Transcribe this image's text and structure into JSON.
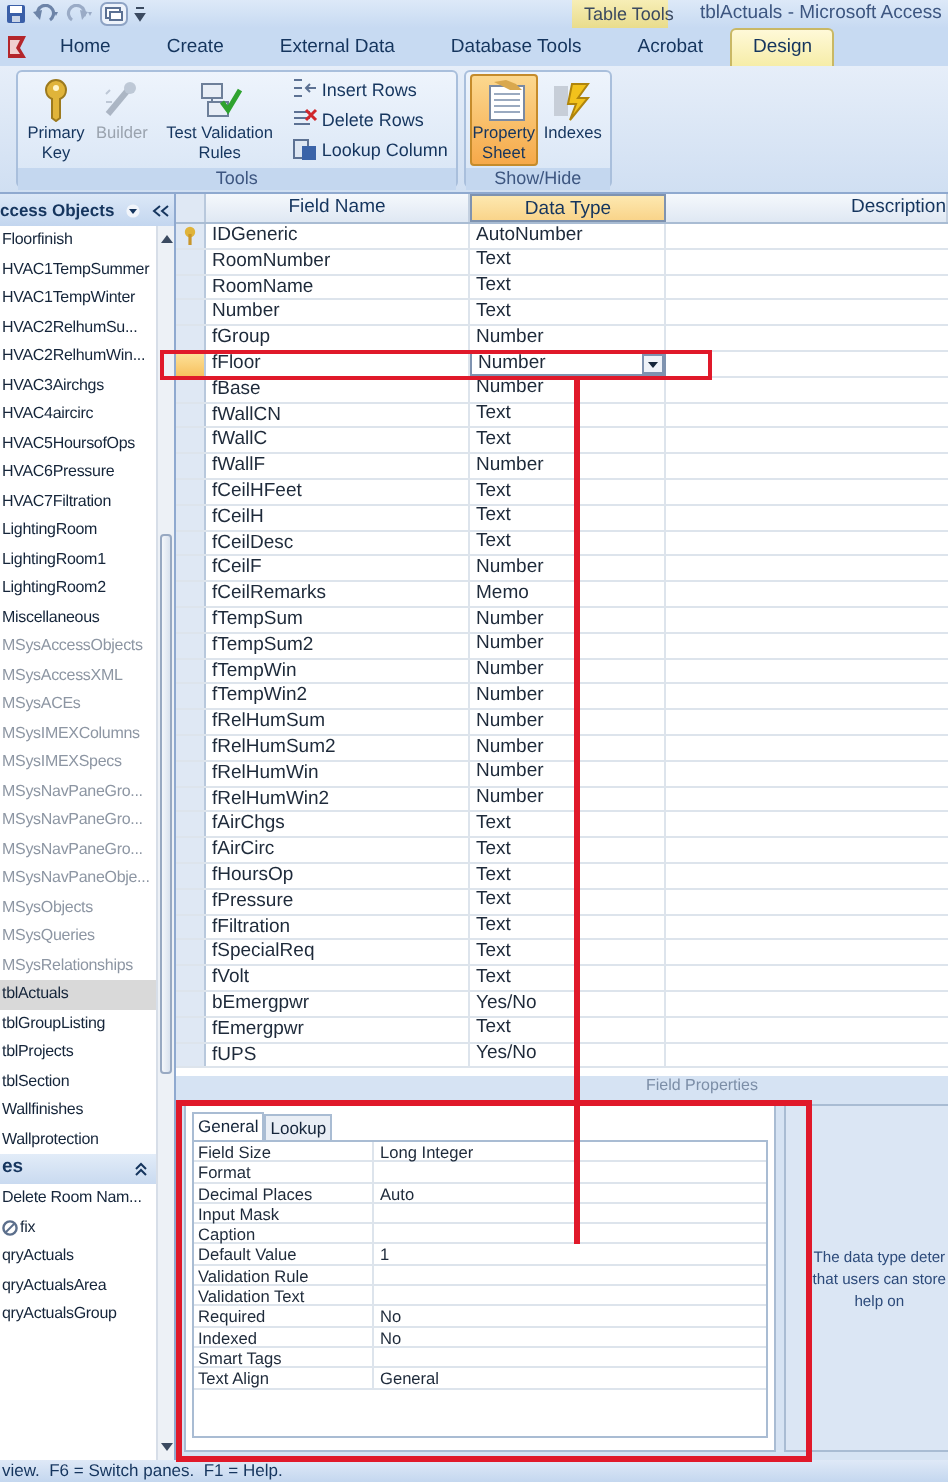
{
  "window": {
    "context_label": "Table Tools",
    "title": "tblActuals - Microsoft Access"
  },
  "tabs": [
    {
      "label": "Home",
      "selected": false
    },
    {
      "label": "Create",
      "selected": false
    },
    {
      "label": "External Data",
      "selected": false
    },
    {
      "label": "Database Tools",
      "selected": false
    },
    {
      "label": "Acrobat",
      "selected": false
    },
    {
      "label": "Design",
      "selected": true
    }
  ],
  "ribbon": {
    "groups": [
      {
        "label": "Tools",
        "buttons": [
          {
            "kind": "large",
            "label": "Primary Key",
            "disabled": false,
            "selected": false
          },
          {
            "kind": "large",
            "label": "Builder",
            "disabled": true,
            "selected": false
          },
          {
            "kind": "large",
            "label": "Test Validation Rules",
            "disabled": false,
            "selected": false
          },
          {
            "kind": "small",
            "label": "Insert Rows",
            "disabled": false,
            "selected": false
          },
          {
            "kind": "small",
            "label": "Delete Rows",
            "disabled": false,
            "selected": false
          },
          {
            "kind": "small",
            "label": "Lookup Column",
            "disabled": false,
            "selected": false
          }
        ]
      },
      {
        "label": "Show/Hide",
        "buttons": [
          {
            "kind": "large",
            "label": "Property Sheet",
            "disabled": false,
            "selected": true
          },
          {
            "kind": "large",
            "label": "Indexes",
            "disabled": false,
            "selected": false
          }
        ]
      }
    ]
  },
  "nav": {
    "header": "ccess Objects",
    "groups": [
      {
        "items": [
          {
            "label": "Floorfinish",
            "dimmed": false,
            "selected": false
          },
          {
            "label": "HVAC1TempSummer",
            "dimmed": false,
            "selected": false
          },
          {
            "label": "HVAC1TempWinter",
            "dimmed": false,
            "selected": false
          },
          {
            "label": "HVAC2RelhumSu...",
            "dimmed": false,
            "selected": false
          },
          {
            "label": "HVAC2RelhumWin...",
            "dimmed": false,
            "selected": false
          },
          {
            "label": "HVAC3Airchgs",
            "dimmed": false,
            "selected": false
          },
          {
            "label": "HVAC4aircirc",
            "dimmed": false,
            "selected": false
          },
          {
            "label": "HVAC5HoursofOps",
            "dimmed": false,
            "selected": false
          },
          {
            "label": "HVAC6Pressure",
            "dimmed": false,
            "selected": false
          },
          {
            "label": "HVAC7Filtration",
            "dimmed": false,
            "selected": false
          },
          {
            "label": "LightingRoom",
            "dimmed": false,
            "selected": false
          },
          {
            "label": "LightingRoom1",
            "dimmed": false,
            "selected": false
          },
          {
            "label": "LightingRoom2",
            "dimmed": false,
            "selected": false
          },
          {
            "label": "Miscellaneous",
            "dimmed": false,
            "selected": false
          },
          {
            "label": "MSysAccessObjects",
            "dimmed": true,
            "selected": false
          },
          {
            "label": "MSysAccessXML",
            "dimmed": true,
            "selected": false
          },
          {
            "label": "MSysACEs",
            "dimmed": true,
            "selected": false
          },
          {
            "label": "MSysIMEXColumns",
            "dimmed": true,
            "selected": false
          },
          {
            "label": "MSysIMEXSpecs",
            "dimmed": true,
            "selected": false
          },
          {
            "label": "MSysNavPaneGro...",
            "dimmed": true,
            "selected": false
          },
          {
            "label": "MSysNavPaneGro...",
            "dimmed": true,
            "selected": false
          },
          {
            "label": "MSysNavPaneGro...",
            "dimmed": true,
            "selected": false
          },
          {
            "label": "MSysNavPaneObje...",
            "dimmed": true,
            "selected": false
          },
          {
            "label": "MSysObjects",
            "dimmed": true,
            "selected": false
          },
          {
            "label": "MSysQueries",
            "dimmed": true,
            "selected": false
          },
          {
            "label": "MSysRelationships",
            "dimmed": true,
            "selected": false
          },
          {
            "label": "tblActuals",
            "dimmed": false,
            "selected": true
          },
          {
            "label": "tblGroupListing",
            "dimmed": false,
            "selected": false
          },
          {
            "label": "tblProjects",
            "dimmed": false,
            "selected": false
          },
          {
            "label": "tblSection",
            "dimmed": false,
            "selected": false
          },
          {
            "label": "Wallfinishes",
            "dimmed": false,
            "selected": false
          },
          {
            "label": "Wallprotection",
            "dimmed": false,
            "selected": false
          }
        ]
      },
      {
        "header": "es",
        "items": [
          {
            "label": "Delete Room Nam...",
            "dimmed": false,
            "selected": false
          },
          {
            "label": "fix",
            "kind": "with_icon",
            "dimmed": false,
            "selected": false
          },
          {
            "label": "qryActuals",
            "dimmed": false,
            "selected": false
          },
          {
            "label": "qryActualsArea",
            "dimmed": false,
            "selected": false
          },
          {
            "label": "qryActualsGroup",
            "dimmed": false,
            "selected": false
          }
        ]
      }
    ]
  },
  "design": {
    "columns": [
      {
        "label": "Field Name",
        "selected": false
      },
      {
        "label": "Data Type",
        "selected": true
      },
      {
        "label": "Description",
        "selected": false
      }
    ],
    "rows": [
      {
        "field": "IDGeneric",
        "type": "AutoNumber",
        "primary_key": true,
        "selected": false
      },
      {
        "field": "RoomNumber",
        "type": "Text",
        "primary_key": false,
        "selected": false
      },
      {
        "field": "RoomName",
        "type": "Text",
        "primary_key": false,
        "selected": false
      },
      {
        "field": "Number",
        "type": "Text",
        "primary_key": false,
        "selected": false
      },
      {
        "field": "fGroup",
        "type": "Number",
        "primary_key": false,
        "selected": false
      },
      {
        "field": "fFloor",
        "type": "Number",
        "primary_key": false,
        "selected": true
      },
      {
        "field": "fBase",
        "type": "Number",
        "primary_key": false,
        "selected": false
      },
      {
        "field": "fWallCN",
        "type": "Text",
        "primary_key": false,
        "selected": false
      },
      {
        "field": "fWallC",
        "type": "Text",
        "primary_key": false,
        "selected": false
      },
      {
        "field": "fWallF",
        "type": "Number",
        "primary_key": false,
        "selected": false
      },
      {
        "field": "fCeilHFeet",
        "type": "Text",
        "primary_key": false,
        "selected": false
      },
      {
        "field": "fCeilH",
        "type": "Text",
        "primary_key": false,
        "selected": false
      },
      {
        "field": "fCeilDesc",
        "type": "Text",
        "primary_key": false,
        "selected": false
      },
      {
        "field": "fCeilF",
        "type": "Number",
        "primary_key": false,
        "selected": false
      },
      {
        "field": "fCeilRemarks",
        "type": "Memo",
        "primary_key": false,
        "selected": false
      },
      {
        "field": "fTempSum",
        "type": "Number",
        "primary_key": false,
        "selected": false
      },
      {
        "field": "fTempSum2",
        "type": "Number",
        "primary_key": false,
        "selected": false
      },
      {
        "field": "fTempWin",
        "type": "Number",
        "primary_key": false,
        "selected": false
      },
      {
        "field": "fTempWin2",
        "type": "Number",
        "primary_key": false,
        "selected": false
      },
      {
        "field": "fRelHumSum",
        "type": "Number",
        "primary_key": false,
        "selected": false
      },
      {
        "field": "fRelHumSum2",
        "type": "Number",
        "primary_key": false,
        "selected": false
      },
      {
        "field": "fRelHumWin",
        "type": "Number",
        "primary_key": false,
        "selected": false
      },
      {
        "field": "fRelHumWin2",
        "type": "Number",
        "primary_key": false,
        "selected": false
      },
      {
        "field": "fAirChgs",
        "type": "Text",
        "primary_key": false,
        "selected": false
      },
      {
        "field": "fAirCirc",
        "type": "Text",
        "primary_key": false,
        "selected": false
      },
      {
        "field": "fHoursOp",
        "type": "Text",
        "primary_key": false,
        "selected": false
      },
      {
        "field": "fPressure",
        "type": "Text",
        "primary_key": false,
        "selected": false
      },
      {
        "field": "fFiltration",
        "type": "Text",
        "primary_key": false,
        "selected": false
      },
      {
        "field": "fSpecialReq",
        "type": "Text",
        "primary_key": false,
        "selected": false
      },
      {
        "field": "fVolt",
        "type": "Text",
        "primary_key": false,
        "selected": false
      },
      {
        "field": "bEmergpwr",
        "type": "Yes/No",
        "primary_key": false,
        "selected": false
      },
      {
        "field": "fEmergpwr",
        "type": "Text",
        "primary_key": false,
        "selected": false
      },
      {
        "field": "fUPS",
        "type": "Yes/No",
        "primary_key": false,
        "selected": false
      }
    ]
  },
  "field_properties": {
    "caption": "Field Properties",
    "tabs": [
      {
        "label": "General",
        "selected": true
      },
      {
        "label": "Lookup",
        "selected": false
      }
    ],
    "rows": [
      {
        "label": "Field Size",
        "value": "Long Integer"
      },
      {
        "label": "Format"
      },
      {
        "label": "Decimal Places",
        "value": "Auto"
      },
      {
        "label": "Input Mask"
      },
      {
        "label": "Caption"
      },
      {
        "label": "Default Value",
        "value": "1"
      },
      {
        "label": "Validation Rule"
      },
      {
        "label": "Validation Text"
      },
      {
        "label": "Required",
        "value": "No"
      },
      {
        "label": "Indexed",
        "value": "No"
      },
      {
        "label": "Smart Tags"
      },
      {
        "label": "Text Align",
        "value": "General"
      }
    ],
    "help_lines": [
      "The data type deter",
      "that users can store",
      "help on"
    ]
  },
  "status_bar": "view.  F6 = Switch panes.  F1 = Help."
}
